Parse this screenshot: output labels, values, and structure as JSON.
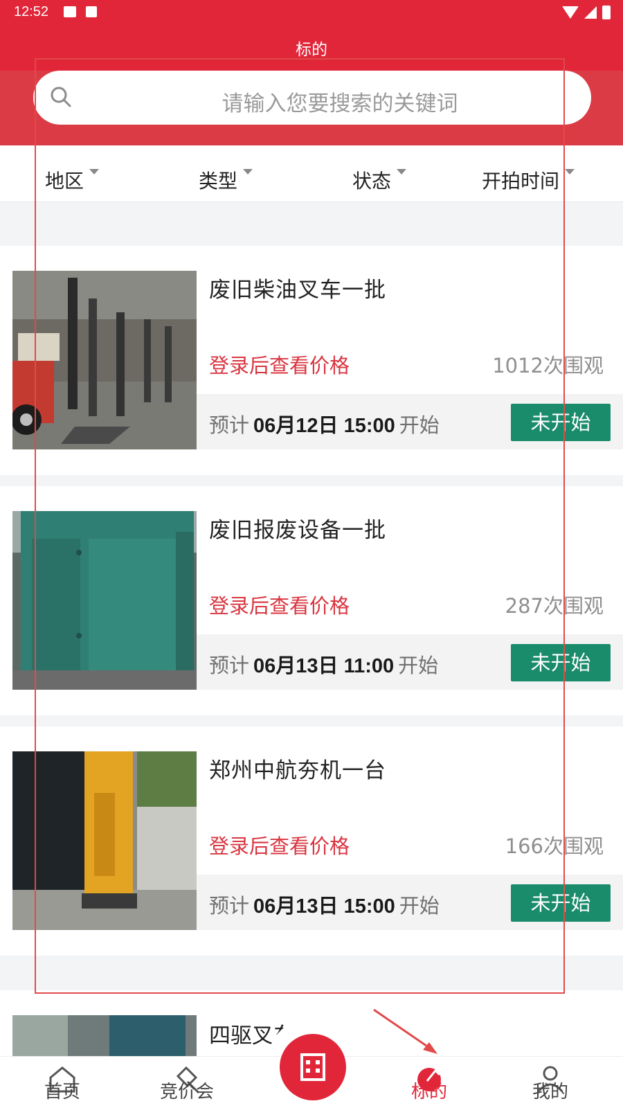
{
  "status_bar": {
    "time": "12:52"
  },
  "header": {
    "title": "标的"
  },
  "search": {
    "placeholder": "请输入您要搜索的关键词"
  },
  "filters": [
    {
      "label": "地区"
    },
    {
      "label": "类型"
    },
    {
      "label": "状态"
    },
    {
      "label": "开拍时间"
    }
  ],
  "items": [
    {
      "name": "废旧柴油叉车一批",
      "price_text": "登录后查看价格",
      "views": "1012次围观",
      "start_prefix": "预计",
      "start_date": "06月12日 15:00",
      "start_suffix": "开始",
      "status": "未开始"
    },
    {
      "name": "废旧报废设备一批",
      "price_text": "登录后查看价格",
      "views": "287次围观",
      "start_prefix": "预计",
      "start_date": "06月13日 11:00",
      "start_suffix": "开始",
      "status": "未开始"
    },
    {
      "name": "郑州中航夯机一台",
      "price_text": "登录后查看价格",
      "views": "166次围观",
      "start_prefix": "预计",
      "start_date": "06月13日 15:00",
      "start_suffix": "开始",
      "status": "未开始"
    },
    {
      "name": "四驱叉车"
    }
  ],
  "bottom_nav": [
    {
      "label": "首页",
      "icon": "home-icon"
    },
    {
      "label": "竞价会",
      "icon": "gavel-icon"
    },
    {
      "label": "",
      "icon": "building-icon"
    },
    {
      "label": "标的",
      "icon": "target-icon",
      "active": true
    },
    {
      "label": "我的",
      "icon": "user-icon"
    }
  ],
  "colors": {
    "brand_red": "#e1263a",
    "status_green": "#1a8b6b",
    "price_red": "#d9343f"
  }
}
